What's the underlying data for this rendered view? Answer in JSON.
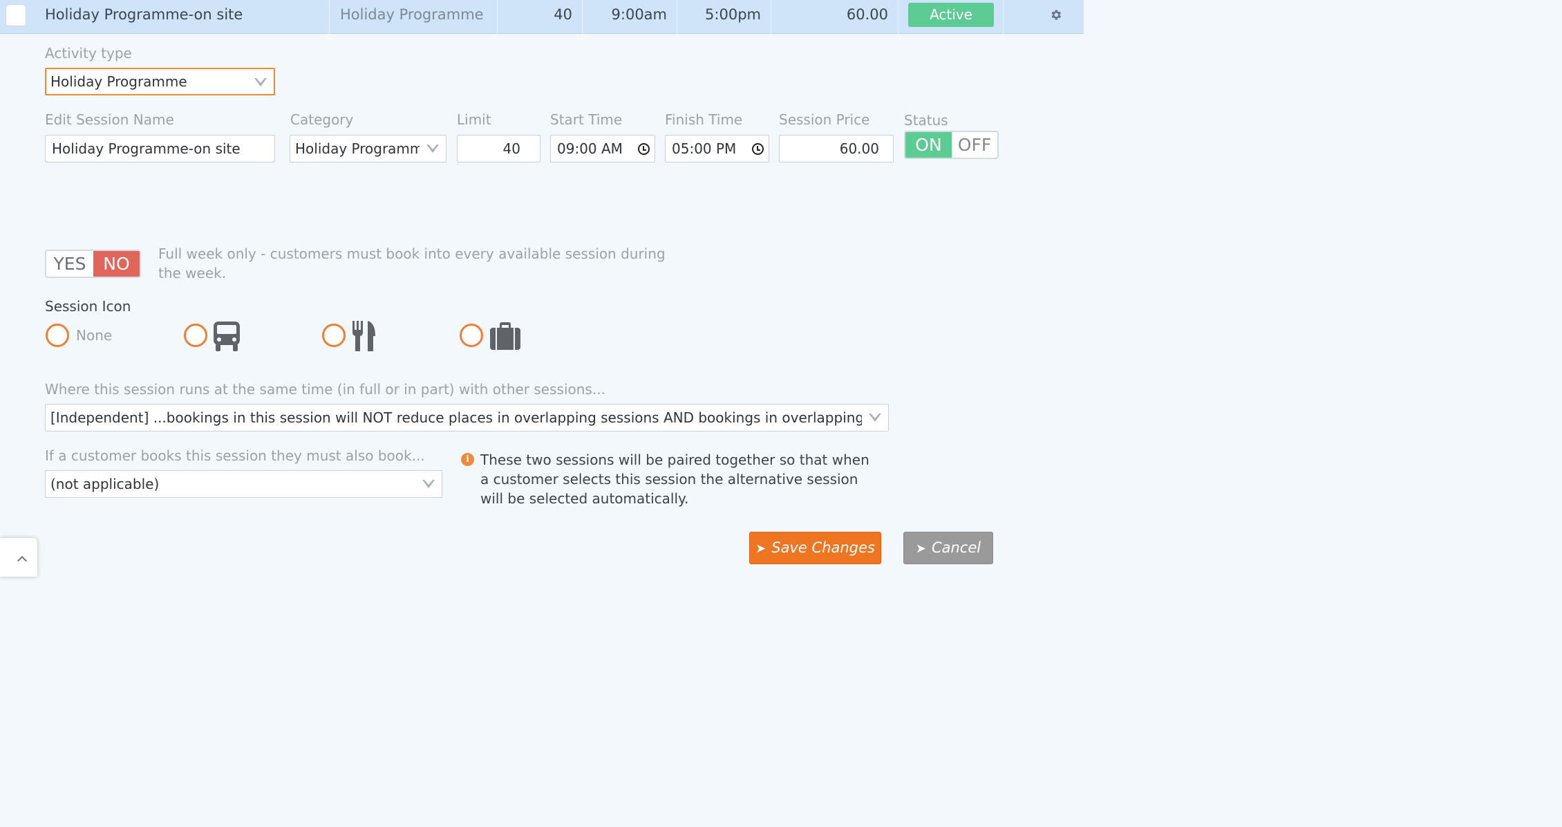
{
  "row": {
    "name": "Holiday Programme-on site",
    "type": "Holiday Programme",
    "limit": "40",
    "start": "9:00am",
    "finish": "5:00pm",
    "price": "60.00",
    "status": "Active"
  },
  "form": {
    "activity_type_label": "Activity type",
    "activity_type_value": "Holiday Programme",
    "session_name_label": "Edit Session Name",
    "session_name_value": "Holiday Programme-on site",
    "category_label": "Category",
    "category_value": "Holiday Programme",
    "limit_label": "Limit",
    "limit_value": "40",
    "start_label": "Start Time",
    "start_value": "09:00 AM",
    "finish_label": "Finish Time",
    "finish_value": "05:00 PM",
    "price_label": "Session Price",
    "price_value": "60.00",
    "status_label": "Status",
    "status_on": "ON",
    "status_off": "OFF",
    "fullweek_yes": "YES",
    "fullweek_no": "NO",
    "fullweek_note": "Full week only - customers must book into every available session during the week.",
    "icon_label": "Session Icon",
    "icon_none": "None",
    "overlap_label": "Where this session runs at the same time (in full or in part) with other sessions...",
    "overlap_value": "[Independent] ...bookings in this session will NOT reduce places in overlapping sessions AND bookings in overlapping sessions",
    "pair_label": "If a customer books this session they must also book...",
    "pair_value": "(not applicable)",
    "pair_info": "These two sessions will be paired together so that when a customer selects this session the alternative session will be selected automatically."
  },
  "buttons": {
    "save": "Save Changes",
    "cancel": "Cancel"
  },
  "colors": {
    "accent_orange": "#ee7521",
    "active_green": "#5dcc94",
    "no_red": "#e0655a",
    "row_blue": "#cfe4f8"
  }
}
